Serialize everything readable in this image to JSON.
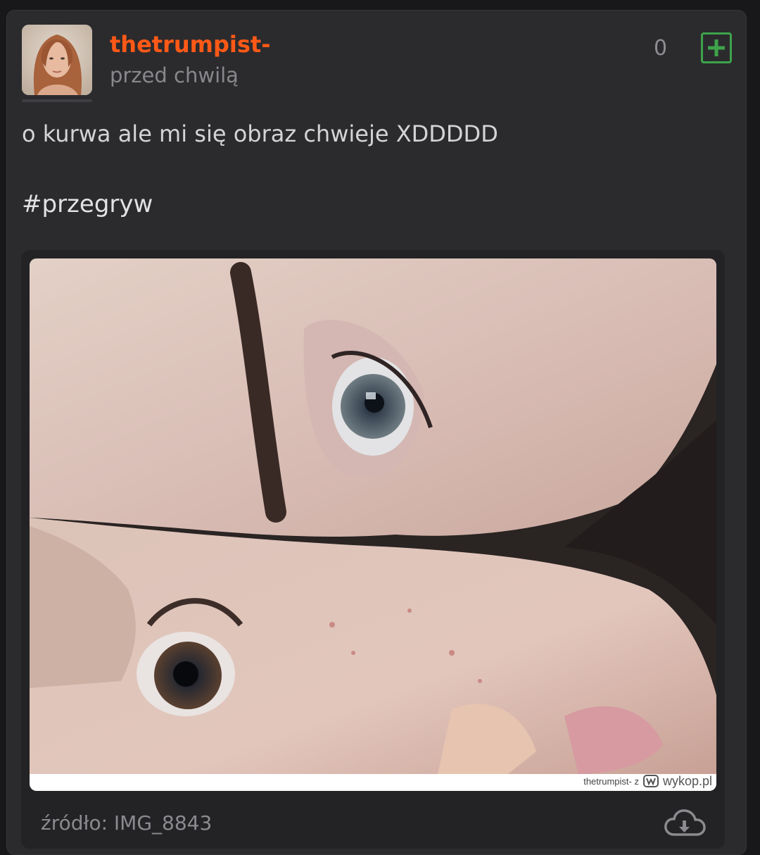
{
  "entry": {
    "author": "thetrumpist-",
    "time": "przed chwilą",
    "votes": "0",
    "text": "o kurwa ale mi się obraz chwieje XDDDDD",
    "tag": "#przegryw"
  },
  "embed": {
    "watermark_prefix": "thetrumpist-  z",
    "watermark_brand": "wykop.pl",
    "source_label": "źródło: IMG_8843"
  },
  "icons": {
    "vote": "plus-icon",
    "download": "cloud-download-icon"
  },
  "colors": {
    "author": "#ff5917",
    "vote_accent": "#3ea34a",
    "card_background": "#2b2b2e",
    "page_background": "#18181a"
  }
}
